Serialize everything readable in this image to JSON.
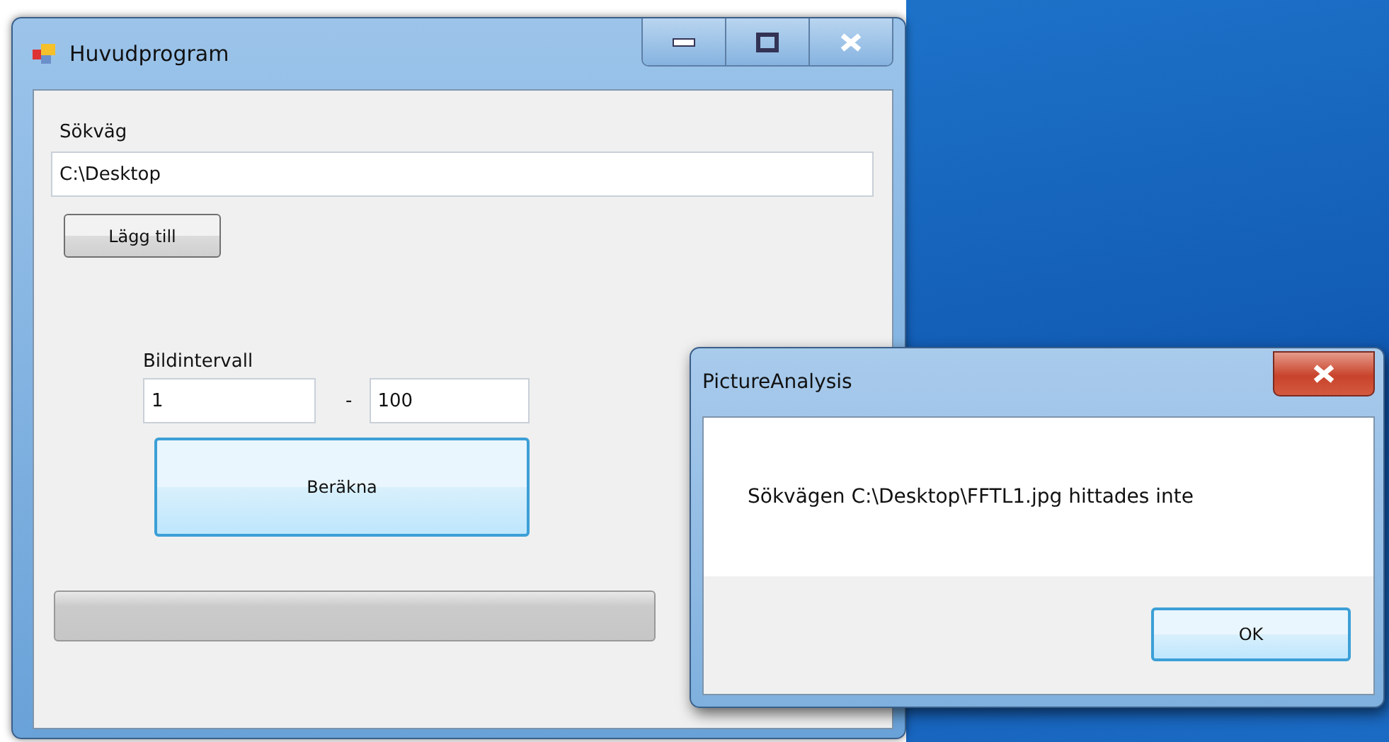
{
  "main_window": {
    "title": "Huvudprogram",
    "path_label": "Sökväg",
    "path_value": "C:\\Desktop",
    "add_button": "Lägg till",
    "interval_label": "Bildintervall",
    "from_value": "1",
    "separator": "-",
    "to_value": "100",
    "compute_button": "Beräkna",
    "progress": {
      "level": 0
    }
  },
  "dialog": {
    "title": "PictureAnalysis",
    "message": "Sökvägen C:\\Desktop\\FFTL1.jpg hittades inte",
    "ok_button": "OK"
  }
}
